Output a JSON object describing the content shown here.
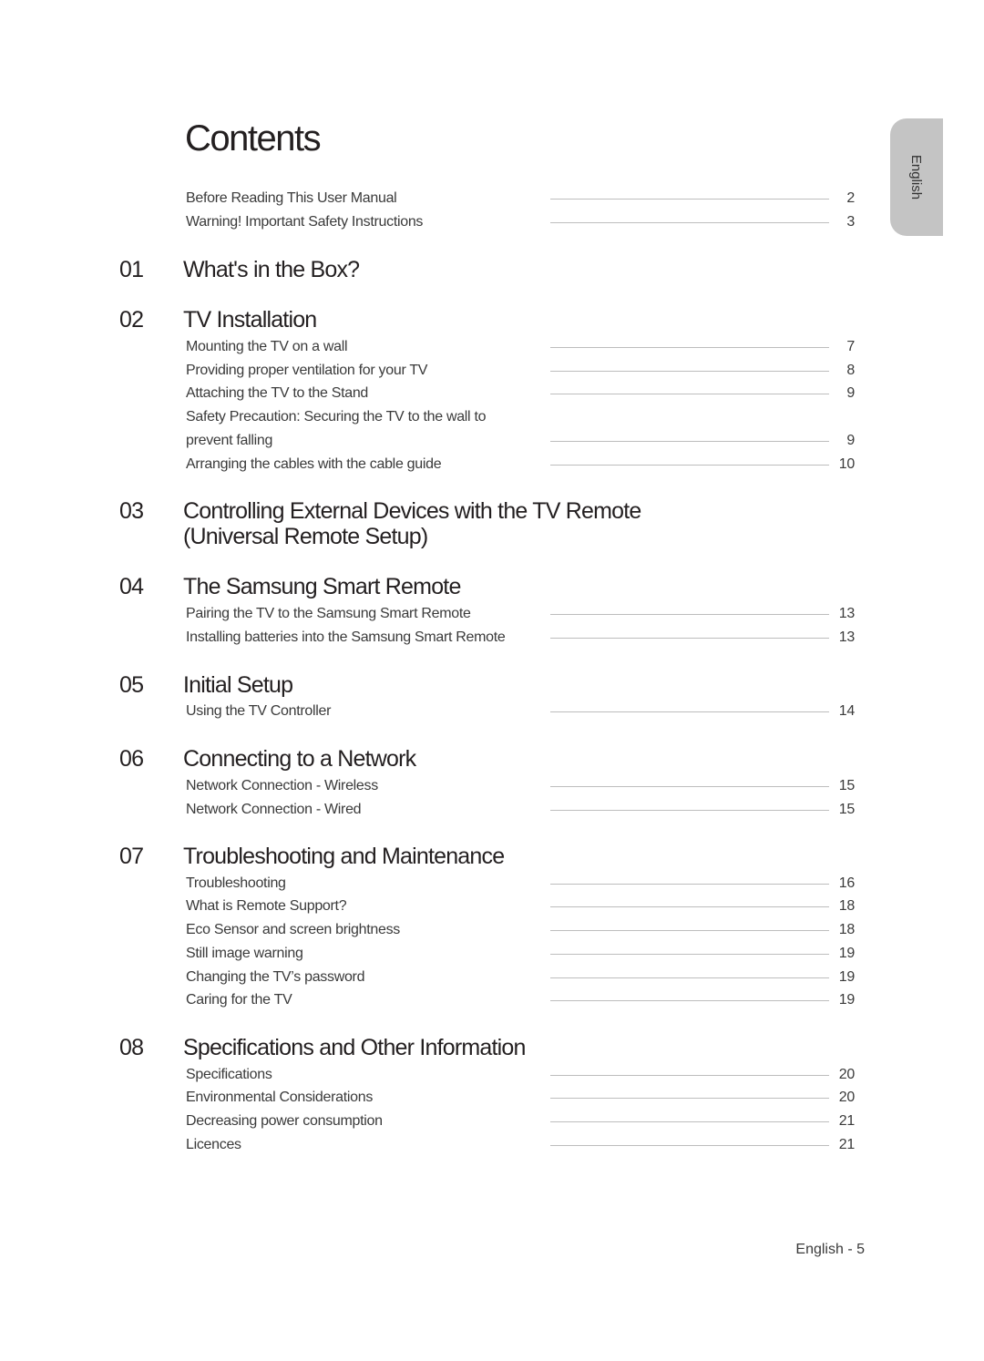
{
  "title": "Contents",
  "language_tab": "English",
  "footer": "English - 5",
  "intro": [
    {
      "label": "Before Reading This User Manual",
      "page": "2"
    },
    {
      "label": "Warning! Important Safety Instructions",
      "page": "3"
    }
  ],
  "chapters": [
    {
      "number": "01",
      "title": "What's in the Box?",
      "entries": []
    },
    {
      "number": "02",
      "title": "TV Installation",
      "entries": [
        {
          "label": "Mounting the TV on a wall",
          "page": "7"
        },
        {
          "label": "Providing proper ventilation for your TV",
          "page": "8"
        },
        {
          "label": "Attaching the TV to the Stand",
          "page": "9"
        },
        {
          "label": "Safety Precaution: Securing the TV to the wall to",
          "page": ""
        },
        {
          "label": "prevent falling",
          "page": "9"
        },
        {
          "label": "Arranging the cables with the cable guide",
          "page": "10"
        }
      ]
    },
    {
      "number": "03",
      "title": "Controlling External Devices with the TV Remote",
      "title_line2": "(Universal Remote Setup)",
      "entries": []
    },
    {
      "number": "04",
      "title": "The Samsung Smart Remote",
      "entries": [
        {
          "label": "Pairing the TV to the Samsung Smart Remote",
          "page": "13"
        },
        {
          "label": "Installing batteries into the Samsung Smart Remote",
          "page": "13"
        }
      ]
    },
    {
      "number": "05",
      "title": "Initial Setup",
      "entries": [
        {
          "label": "Using the TV Controller",
          "page": "14"
        }
      ]
    },
    {
      "number": "06",
      "title": "Connecting to a Network",
      "entries": [
        {
          "label": "Network Connection - Wireless",
          "page": "15"
        },
        {
          "label": "Network Connection - Wired",
          "page": "15"
        }
      ]
    },
    {
      "number": "07",
      "title": "Troubleshooting and Maintenance",
      "entries": [
        {
          "label": "Troubleshooting",
          "page": "16"
        },
        {
          "label": "What is Remote Support?",
          "page": "18"
        },
        {
          "label": "Eco Sensor and screen brightness",
          "page": "18"
        },
        {
          "label": "Still image warning",
          "page": "19"
        },
        {
          "label": "Changing the TV’s password",
          "page": "19"
        },
        {
          "label": "Caring for the TV",
          "page": "19"
        }
      ]
    },
    {
      "number": "08",
      "title": "Specifications and Other Information",
      "entries": [
        {
          "label": "Specifications",
          "page": "20"
        },
        {
          "label": "Environmental Considerations",
          "page": "20"
        },
        {
          "label": "Decreasing power consumption",
          "page": "21"
        },
        {
          "label": "Licences",
          "page": "21"
        }
      ]
    }
  ]
}
